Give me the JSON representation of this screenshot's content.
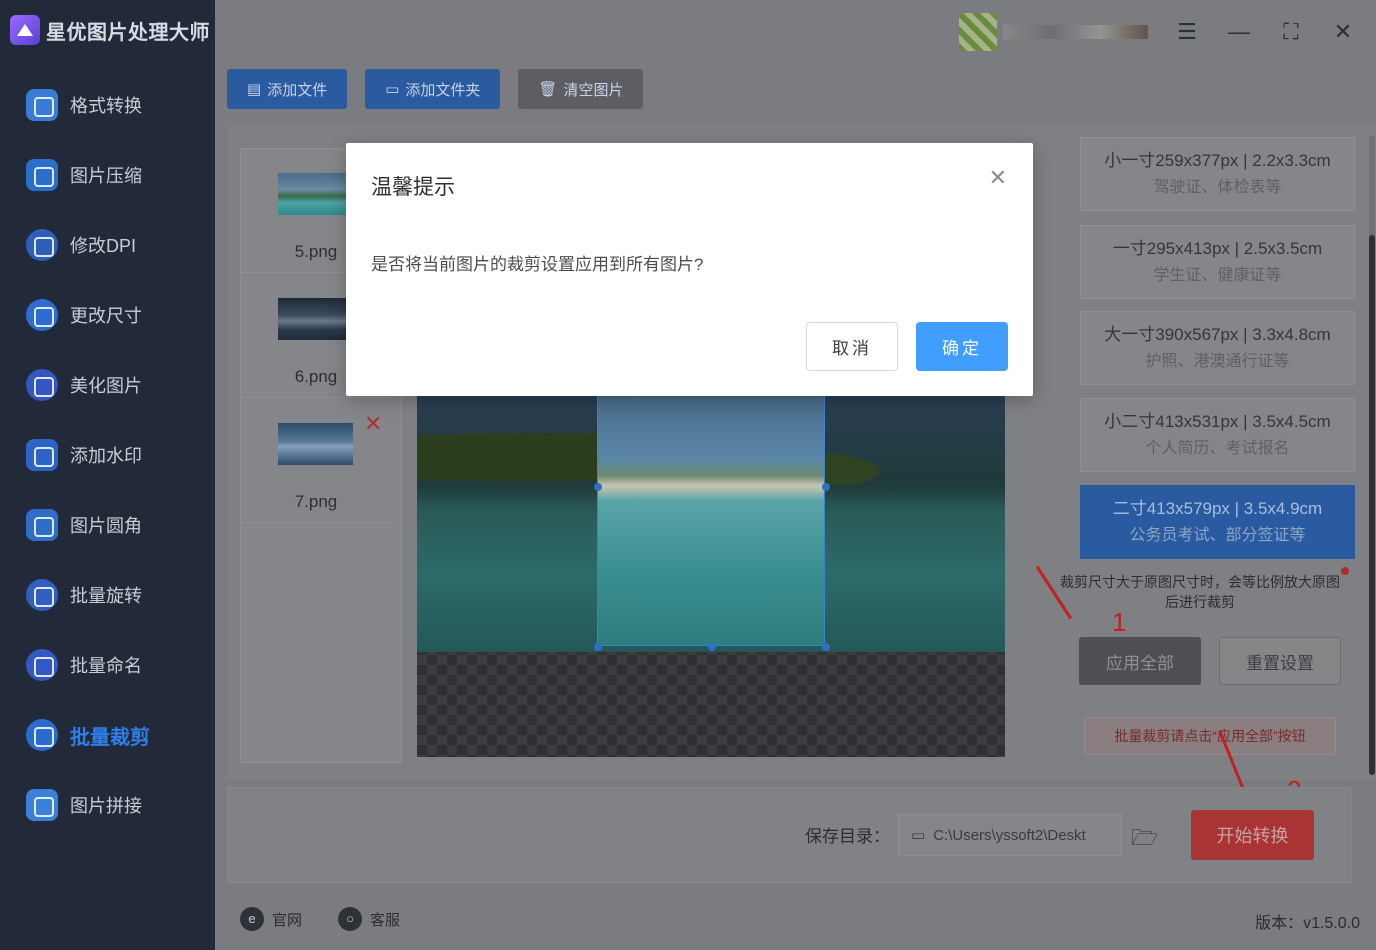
{
  "app": {
    "name": "星优图片处理大师"
  },
  "sidebar": {
    "items": [
      {
        "label": "格式转换",
        "icon": "image-convert-icon",
        "color": "#3a7bd5"
      },
      {
        "label": "图片压缩",
        "icon": "compress-icon",
        "color": "#2a6fc9"
      },
      {
        "label": "修改DPI",
        "icon": "dpi-icon",
        "color": "#2d5fb8"
      },
      {
        "label": "更改尺寸",
        "icon": "resize-icon",
        "color": "#2e6cd0"
      },
      {
        "label": "美化图片",
        "icon": "beautify-icon",
        "color": "#3456c2"
      },
      {
        "label": "添加水印",
        "icon": "watermark-icon",
        "color": "#2e63c6"
      },
      {
        "label": "图片圆角",
        "icon": "round-corner-icon",
        "color": "#2f6ec8"
      },
      {
        "label": "批量旋转",
        "icon": "rotate-icon",
        "color": "#2f5fbf"
      },
      {
        "label": "批量命名",
        "icon": "rename-icon",
        "color": "#3358c3"
      },
      {
        "label": "批量裁剪",
        "icon": "crop-icon",
        "color": "#2a6bd0",
        "active": true
      },
      {
        "label": "图片拼接",
        "icon": "puzzle-icon",
        "color": "#3a7fd8"
      }
    ]
  },
  "toolbar": {
    "add_file": "添加文件",
    "add_folder": "添加文件夹",
    "clear": "清空图片"
  },
  "files": [
    {
      "name": "5.png"
    },
    {
      "name": "6.png"
    },
    {
      "name": "7.png"
    }
  ],
  "sizes": [
    {
      "main": "小一寸259x377px | 2.2x3.3cm",
      "sub": "驾驶证、体检表等"
    },
    {
      "main": "一寸295x413px | 2.5x3.5cm",
      "sub": "学生证、健康证等"
    },
    {
      "main": "大一寸390x567px | 3.3x4.8cm",
      "sub": "护照、港澳通行证等"
    },
    {
      "main": "小二寸413x531px | 3.5x4.5cm",
      "sub": "个人简历、考试报名"
    },
    {
      "main": "二寸413x579px | 3.5x4.9cm",
      "sub": "公务员考试、部分签证等",
      "selected": true
    }
  ],
  "crop_note": "裁剪尺寸大于原图尺寸时，会等比例放大原图后进行裁剪",
  "buttons": {
    "apply_all": "应用全部",
    "reset": "重置设置",
    "batch_hint": "批量裁剪请点击“应用全部”按钮",
    "start": "开始转换"
  },
  "markers": {
    "one": "1",
    "two": "2"
  },
  "save": {
    "label": "保存目录：",
    "path": "C:\\Users\\yssoft2\\Deskt"
  },
  "footer": {
    "website": "官网",
    "support": "客服",
    "version": "版本：v1.5.0.0"
  },
  "dialog": {
    "title": "温馨提示",
    "message": "是否将当前图片的裁剪设置应用到所有图片?",
    "cancel": "取消",
    "ok": "确定"
  },
  "colors": {
    "accent": "#409eff",
    "danger": "#c42020"
  }
}
